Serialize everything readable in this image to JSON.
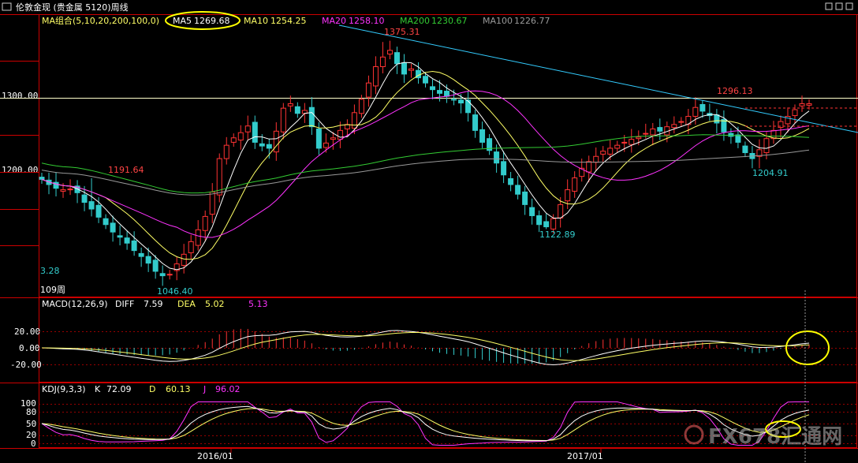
{
  "header": {
    "title": "伦敦金现 (贵金属 5120)周线",
    "icons": [
      "window-icon",
      "restore-icon",
      "close-icon"
    ]
  },
  "ma_legend": {
    "group": "MA组合(5,10,20,200,100,0)",
    "items": [
      {
        "label": "MA5",
        "value": "1269.68",
        "color": "#ffffff",
        "highlighted": true
      },
      {
        "label": "MA10",
        "value": "1254.25",
        "color": "#ffff66"
      },
      {
        "label": "MA20",
        "value": "1258.10",
        "color": "#ff33ff"
      },
      {
        "label": "MA200",
        "value": "1230.67",
        "color": "#33cc33"
      },
      {
        "label": "MA100",
        "value": "1226.77",
        "color": "#999999"
      }
    ]
  },
  "price_axis": {
    "ticks": [
      "1300.00",
      "1200.00"
    ]
  },
  "price_annotations": [
    {
      "text": "1191.64",
      "color": "#ff4444"
    },
    {
      "text": "1375.31",
      "color": "#ff4444"
    },
    {
      "text": "1296.13",
      "color": "#ff4444"
    },
    {
      "text": "1122.89",
      "color": "#33cccc"
    },
    {
      "text": "1204.91",
      "color": "#33cccc"
    },
    {
      "text": "1046.40",
      "color": "#33cccc"
    },
    {
      "text": "3.28",
      "color": "#33cccc"
    },
    {
      "text": "109周",
      "color": "#ffffff"
    }
  ],
  "macd": {
    "label": "MACD(12,26,9)",
    "diff_label": "DIFF",
    "diff": "7.59",
    "dea_label": "DEA",
    "dea": "5.02",
    "macd": "5.13",
    "axis": [
      "20.00",
      "0.00",
      "-20.00"
    ]
  },
  "kdj": {
    "label": "KDJ(9,3,3)",
    "k_label": "K",
    "k": "72.09",
    "d_label": "D",
    "d": "60.13",
    "j_label": "J",
    "j": "96.02",
    "axis": [
      "100",
      "80",
      "50",
      "20",
      "0"
    ]
  },
  "x_axis": {
    "labels": [
      "2016/01",
      "2017/01"
    ]
  },
  "watermark": {
    "text": "FX678汇通网"
  },
  "colors": {
    "up": "#ff3333",
    "down": "#33cccc",
    "grid": "#990000",
    "axis": "#cc0000",
    "ma5": "#ffffff",
    "ma10": "#ffff66",
    "ma20": "#ff33ff",
    "ma200": "#33cc33",
    "ma100": "#999999",
    "trend": "#33ccff",
    "highlight": "#ffff00"
  },
  "chart_data": [
    {
      "type": "candlestick",
      "title": "伦敦金现 (贵金属 5120)周线",
      "yticks": [
        1200,
        1300
      ],
      "ylim": [
        1030,
        1390
      ],
      "closes": [
        1190,
        1183,
        1178,
        1176,
        1177,
        1172,
        1159,
        1150,
        1139,
        1129,
        1119,
        1112,
        1104,
        1094,
        1086,
        1077,
        1066,
        1060,
        1062,
        1076,
        1089,
        1106,
        1122,
        1140,
        1173,
        1218,
        1236,
        1246,
        1253,
        1262,
        1240,
        1235,
        1232,
        1255,
        1286,
        1292,
        1279,
        1283,
        1261,
        1232,
        1239,
        1246,
        1256,
        1264,
        1280,
        1298,
        1320,
        1342,
        1355,
        1364,
        1346,
        1332,
        1339,
        1327,
        1320,
        1311,
        1306,
        1302,
        1297,
        1293,
        1280,
        1256,
        1240,
        1229,
        1212,
        1196,
        1183,
        1170,
        1156,
        1141,
        1129,
        1126,
        1137,
        1156,
        1176,
        1192,
        1205,
        1214,
        1221,
        1228,
        1232,
        1236,
        1240,
        1244,
        1247,
        1252,
        1258,
        1255,
        1261,
        1264,
        1268,
        1275,
        1287,
        1282,
        1276,
        1266,
        1254,
        1248,
        1240,
        1226,
        1218,
        1230,
        1245,
        1256,
        1268,
        1275,
        1284,
        1292,
        1292
      ],
      "highs": {
        "1191.64": 7,
        "1375.31": 48,
        "1296.13": 93
      },
      "lows": {
        "1046.40": 17,
        "1122.89": 71,
        "1204.91": 101
      },
      "x_labels": [
        "2016/01",
        "2017/01"
      ]
    },
    {
      "type": "line",
      "title": "MACD(12,26,9)",
      "series": [
        {
          "name": "DIFF",
          "last": 7.59
        },
        {
          "name": "DEA",
          "last": 5.02
        },
        {
          "name": "MACD",
          "last": 5.13
        }
      ],
      "yticks": [
        20,
        0,
        -20
      ]
    },
    {
      "type": "line",
      "title": "KDJ(9,3,3)",
      "series": [
        {
          "name": "K",
          "last": 72.09
        },
        {
          "name": "D",
          "last": 60.13
        },
        {
          "name": "J",
          "last": 96.02
        }
      ],
      "yticks": [
        100,
        80,
        50,
        20,
        0
      ]
    }
  ]
}
